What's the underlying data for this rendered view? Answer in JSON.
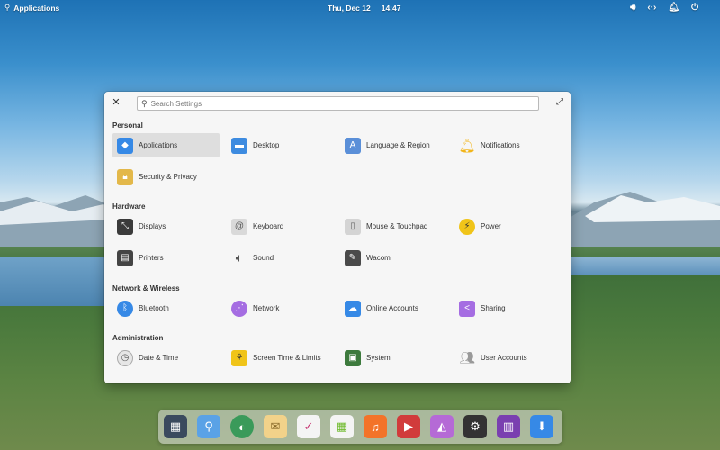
{
  "topbar": {
    "applications_label": "Applications",
    "date": "Thu, Dec 12",
    "time": "14:47",
    "indicators": [
      "volume-icon",
      "network-icon",
      "notifications-icon",
      "power-icon"
    ]
  },
  "window": {
    "search_placeholder": "Search Settings",
    "sections": {
      "personal": {
        "title": "Personal",
        "items": [
          "Applications",
          "Desktop",
          "Language & Region",
          "Notifications",
          "Security & Privacy"
        ]
      },
      "hardware": {
        "title": "Hardware",
        "items": [
          "Displays",
          "Keyboard",
          "Mouse & Touchpad",
          "Power",
          "Printers",
          "Sound",
          "Wacom"
        ]
      },
      "network": {
        "title": "Network & Wireless",
        "items": [
          "Bluetooth",
          "Network",
          "Online Accounts",
          "Sharing"
        ]
      },
      "admin": {
        "title": "Administration",
        "items": [
          "Date & Time",
          "Screen Time & Limits",
          "System",
          "User Accounts"
        ]
      }
    }
  },
  "dock": {
    "apps": [
      "multitasking-view",
      "files",
      "web-browser",
      "mail",
      "tasks",
      "calendar",
      "music",
      "videos",
      "photos",
      "system-settings",
      "app-center",
      "installer"
    ]
  },
  "colors": {
    "window_bg": "#f6f6f6",
    "selected_bg": "#dedede",
    "accent": "#3689e6"
  }
}
